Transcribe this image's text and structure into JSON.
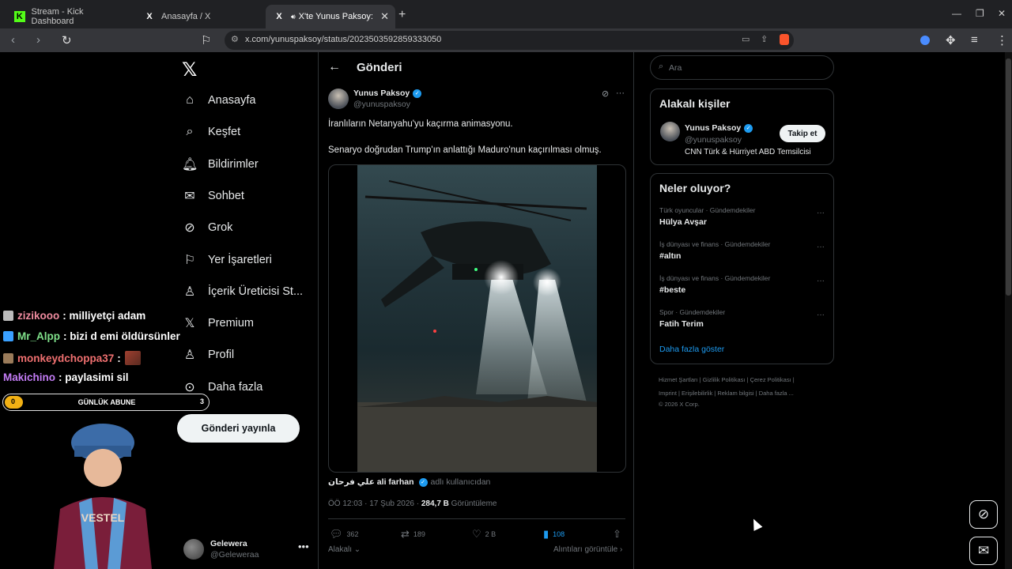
{
  "browser": {
    "tabs": [
      {
        "title": "Stream - Kick Dashboard",
        "favicon": "K"
      },
      {
        "title": "Anasayfa / X",
        "favicon": "X"
      },
      {
        "title": "X'te Yunus Paksoy: \"İranlıla",
        "favicon": "X"
      }
    ],
    "new_tab": "+",
    "url": "x.com/yunuspaksoy/status/2023503592859333050"
  },
  "nav": {
    "items": [
      {
        "label": "Anasayfa",
        "icon": "home-icon",
        "glyph": "⌂"
      },
      {
        "label": "Keşfet",
        "icon": "search-icon",
        "glyph": "⌕"
      },
      {
        "label": "Bildirimler",
        "icon": "bell-icon",
        "glyph": "🔔︎"
      },
      {
        "label": "Sohbet",
        "icon": "mail-icon",
        "glyph": "✉"
      },
      {
        "label": "Grok",
        "icon": "grok-icon",
        "glyph": "⊘"
      },
      {
        "label": "Yer İşaretleri",
        "icon": "bookmark-icon",
        "glyph": "⚐"
      },
      {
        "label": "İçerik Üreticisi St...",
        "icon": "creator-icon",
        "glyph": "♙"
      },
      {
        "label": "Premium",
        "icon": "x-premium-icon",
        "glyph": "𝕏"
      },
      {
        "label": "Profil",
        "icon": "person-icon",
        "glyph": "♙"
      },
      {
        "label": "Daha fazla",
        "icon": "more-circle-icon",
        "glyph": "⊙"
      }
    ],
    "post_button": "Gönderi yayınla",
    "account": {
      "name": "Gelewera",
      "handle": "@Geleweraa"
    }
  },
  "post": {
    "header": "Gönderi",
    "author": {
      "name": "Yunus Paksoy",
      "handle": "@yunuspaksoy"
    },
    "text1": "İranlıların Netanyahu'yu kaçırma animasyonu.",
    "text2": "Senaryo doğrudan Trump'ın anlattığı Maduro'nun kaçırılması olmuş.",
    "via_name": "علي فرحان ali farhan",
    "via_suffix": "adlı kullanıcıdan",
    "time": "ÖÖ 12:03 · 17 Şub 2026 ·",
    "views": "284,7 B",
    "views_label": "Görüntüleme",
    "stats": {
      "replies": "362",
      "reposts": "189",
      "likes": "2 B",
      "bookmarks": "108"
    },
    "related": "Alakalı",
    "quotes": "Alıntıları görüntüle"
  },
  "sidebar": {
    "search_placeholder": "Ara",
    "related_title": "Alakalı kişiler",
    "related_person": {
      "name": "Yunus Paksoy",
      "handle": "@yunuspaksoy",
      "bio": "CNN Türk & Hürriyet ABD Temsilcisi",
      "follow": "Takip et"
    },
    "trends_title": "Neler oluyor?",
    "trends": [
      {
        "category": "Türk oyuncular · Gündemdekiler",
        "name": "Hülya Avşar"
      },
      {
        "category": "İş dünyası ve finans · Gündemdekiler",
        "name": "#altın"
      },
      {
        "category": "İş dünyası ve finans · Gündemdekiler",
        "name": "#beste"
      },
      {
        "category": "Spor · Gündemdekiler",
        "name": "Fatih Terim"
      }
    ],
    "show_more": "Daha fazla göster",
    "footer_line1": "Hizmet Şartları  |  Gizlilik Politikası  |  Çerez Politikası  |",
    "footer_line2": "Imprint  |  Erişilebilirlik  |  Reklam bilgisi  |  Daha fazla ...",
    "footer_line3": "© 2026 X Corp."
  },
  "stream": {
    "chat": [
      {
        "user": "zizikooo",
        "color": "#f08ca0",
        "msg": ": milliyetçi adam"
      },
      {
        "user": "Mr_Alpp",
        "color": "#7fe08a",
        "msg": ": bizi d emi öldürsünler"
      },
      {
        "user": "monkeydchoppa37",
        "color": "#f07070",
        "msg": ":"
      },
      {
        "user": "Makichino",
        "color": "#c37cf5",
        "msg": ": paylasimi sil"
      }
    ],
    "sub_goal": {
      "current": "0",
      "label": "GÜNLÜK ABUNE",
      "target": "3",
      "progress": 0
    }
  },
  "colors": {
    "accent": "#1d9bf0",
    "background": "#000000",
    "gold": "#f2b114"
  }
}
